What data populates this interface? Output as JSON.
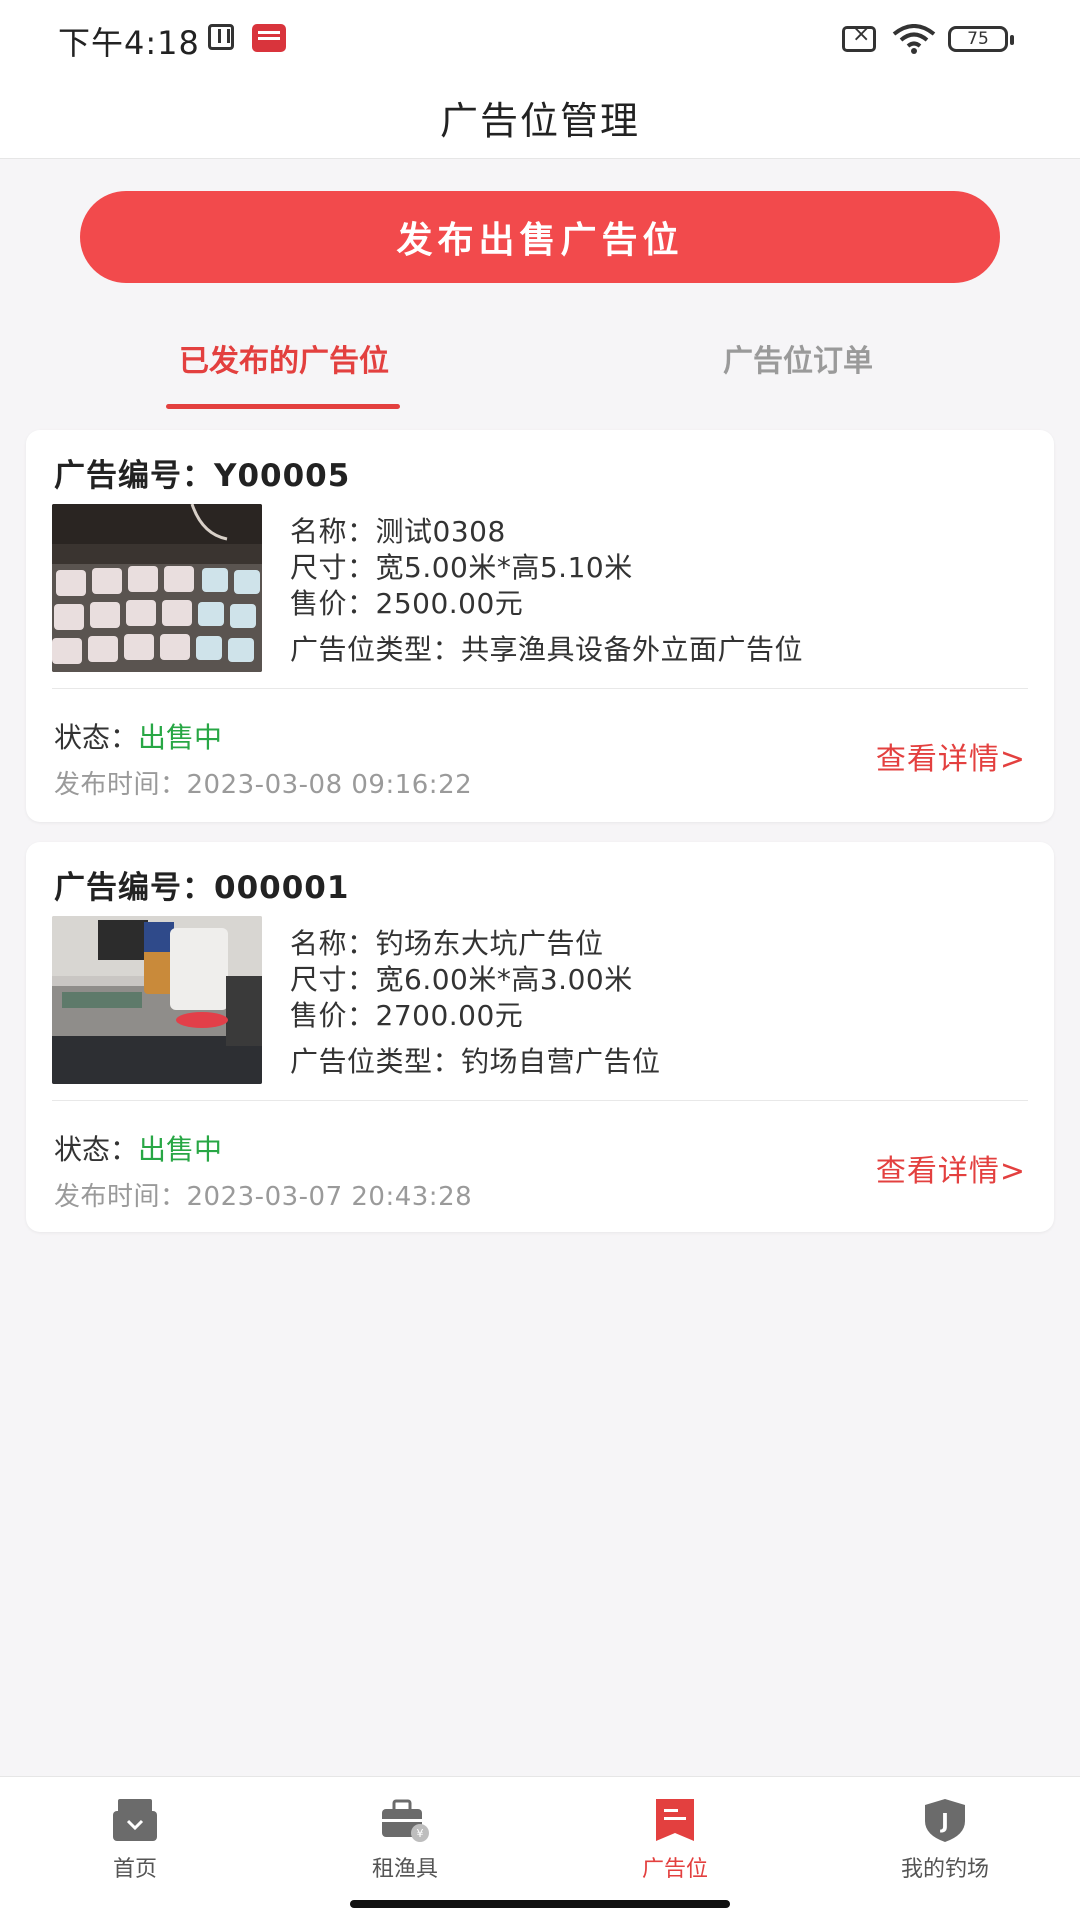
{
  "status_bar": {
    "time": "下午4:18",
    "battery": "75"
  },
  "header": {
    "title": "广告位管理"
  },
  "publish_button": "发布出售广告位",
  "tabs": [
    {
      "label": "已发布的广告位",
      "active": true
    },
    {
      "label": "广告位订单",
      "active": false
    }
  ],
  "labels": {
    "ad_no": "广告编号：",
    "name": "名称：",
    "size": "尺寸：",
    "price": "售价：",
    "type": "广告位类型：",
    "status": "状态：",
    "publish_time": "发布时间："
  },
  "ads": [
    {
      "id": "Y00005",
      "name": "测试0308",
      "size": "宽5.00米*高5.10米",
      "price": "2500.00元",
      "type": "共享渔具设备外立面广告位",
      "status": "出售中",
      "publish_time": "2023-03-08 09:16:22",
      "detail_link": "查看详情>"
    },
    {
      "id": "000001",
      "name": "钓场东大坑广告位",
      "size": "宽6.00米*高3.00米",
      "price": "2700.00元",
      "type": "钓场自营广告位",
      "status": "出售中",
      "publish_time": "2023-03-07 20:43:28",
      "detail_link": "查看详情>"
    }
  ],
  "bottom_nav": [
    {
      "label": "首页",
      "icon": "home-box-icon",
      "active": false
    },
    {
      "label": "租渔具",
      "icon": "toolbox-icon",
      "active": false
    },
    {
      "label": "广告位",
      "icon": "ad-doc-icon",
      "active": true
    },
    {
      "label": "我的钓场",
      "icon": "shield-j-icon",
      "active": false
    }
  ],
  "colors": {
    "accent": "#f24a4c",
    "status_green": "#28a745",
    "link_red": "#e3403f"
  }
}
